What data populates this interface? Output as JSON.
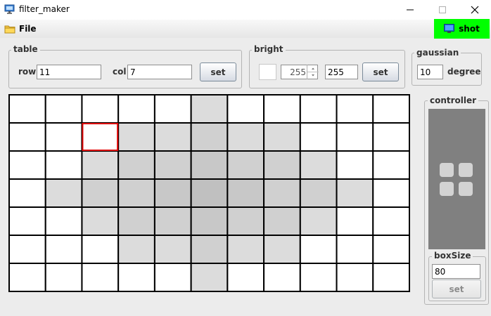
{
  "window": {
    "title": "filter_maker"
  },
  "menu": {
    "file_label": "File",
    "shot_label": "shot"
  },
  "table": {
    "legend": "table",
    "row_label": "row",
    "row_value": "11",
    "col_label": "col",
    "col_value": "7",
    "set_label": "set"
  },
  "bright": {
    "legend": "bright",
    "spinner_value": "255",
    "value": "255",
    "set_label": "set"
  },
  "gaussian": {
    "legend": "gaussian",
    "value": "10",
    "degree_label": "degree"
  },
  "controller": {
    "legend": "controller",
    "box_size_legend": "boxSize",
    "box_size_value": "80",
    "set_label": "set"
  },
  "grid": {
    "rows": 7,
    "cols": 11,
    "selected_cell": {
      "row": 1,
      "col": 2
    },
    "cell_colors": [
      [
        "#ffffff",
        "#ffffff",
        "#ffffff",
        "#ffffff",
        "#ffffff",
        "#dcdcdc",
        "#ffffff",
        "#ffffff",
        "#ffffff",
        "#ffffff",
        "#ffffff"
      ],
      [
        "#ffffff",
        "#ffffff",
        "#ffffff",
        "#dcdcdc",
        "#dcdcdc",
        "#d0d0d0",
        "#dcdcdc",
        "#dcdcdc",
        "#ffffff",
        "#ffffff",
        "#ffffff"
      ],
      [
        "#ffffff",
        "#ffffff",
        "#dcdcdc",
        "#d0d0d0",
        "#d0d0d0",
        "#c8c8c8",
        "#d0d0d0",
        "#d0d0d0",
        "#dcdcdc",
        "#ffffff",
        "#ffffff"
      ],
      [
        "#ffffff",
        "#dcdcdc",
        "#d0d0d0",
        "#d0d0d0",
        "#c8c8c8",
        "#c0c0c0",
        "#c8c8c8",
        "#d0d0d0",
        "#d0d0d0",
        "#dcdcdc",
        "#ffffff"
      ],
      [
        "#ffffff",
        "#ffffff",
        "#dcdcdc",
        "#d0d0d0",
        "#d0d0d0",
        "#c8c8c8",
        "#d0d0d0",
        "#d0d0d0",
        "#dcdcdc",
        "#ffffff",
        "#ffffff"
      ],
      [
        "#ffffff",
        "#ffffff",
        "#ffffff",
        "#dcdcdc",
        "#dcdcdc",
        "#d0d0d0",
        "#dcdcdc",
        "#dcdcdc",
        "#ffffff",
        "#ffffff",
        "#ffffff"
      ],
      [
        "#ffffff",
        "#ffffff",
        "#ffffff",
        "#ffffff",
        "#ffffff",
        "#dcdcdc",
        "#ffffff",
        "#ffffff",
        "#ffffff",
        "#ffffff",
        "#ffffff"
      ]
    ],
    "selection_color": "#e00000"
  },
  "icons": {
    "app": "app-window-icon",
    "folder": "folder-icon",
    "monitor": "monitor-icon"
  },
  "colors": {
    "shot_bg": "#00ff00",
    "pad_bg": "#808080",
    "pad_squares": "#d3d3d3"
  }
}
